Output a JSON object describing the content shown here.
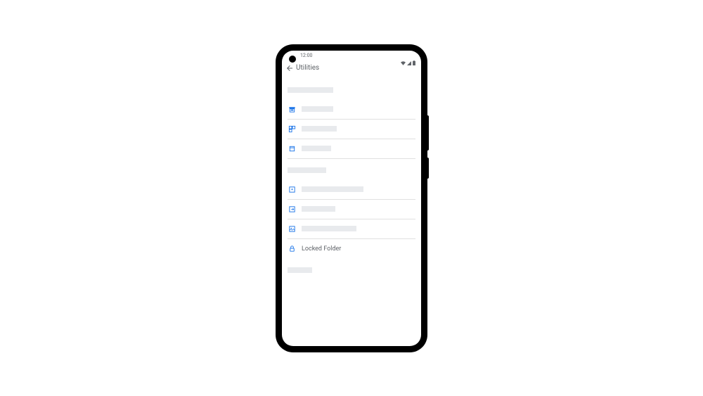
{
  "status": {
    "time": "12:00"
  },
  "header": {
    "title": "Utilities"
  },
  "sections": {
    "locked_folder_label": "Locked Folder"
  },
  "colors": {
    "accent": "#1a73e8",
    "placeholder": "#e8eaed",
    "text_secondary": "#5f6368"
  }
}
